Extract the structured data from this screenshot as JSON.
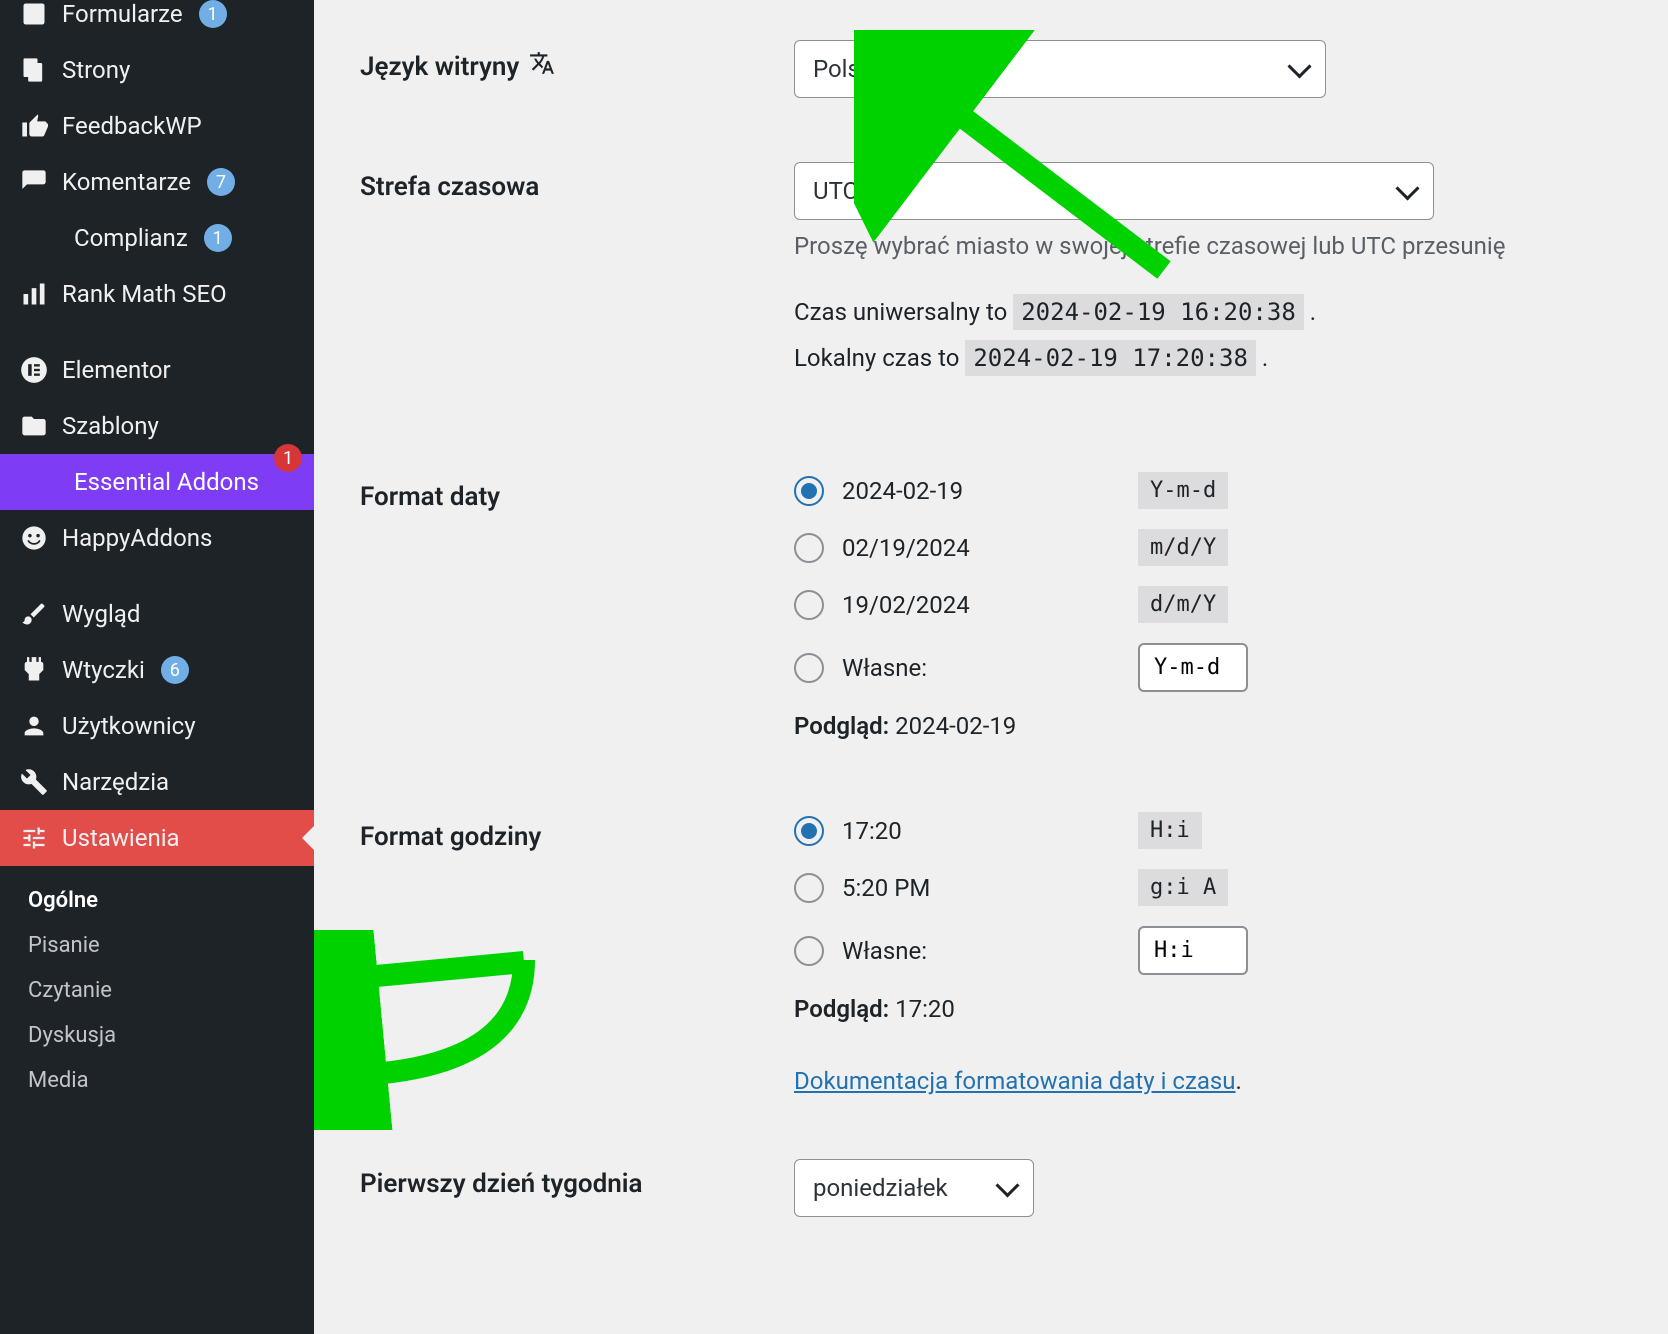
{
  "sidebar": {
    "items": {
      "formularze": {
        "label": "Formularze",
        "badge": "1"
      },
      "strony": {
        "label": "Strony"
      },
      "feedbackwp": {
        "label": "FeedbackWP"
      },
      "komentarze": {
        "label": "Komentarze",
        "badge": "7"
      },
      "complianz": {
        "label": "Complianz",
        "badge": "1"
      },
      "rankmath": {
        "label": "Rank Math SEO"
      },
      "elementor": {
        "label": "Elementor"
      },
      "szablony": {
        "label": "Szablony"
      },
      "essential": {
        "label": "Essential Addons",
        "badge": "1"
      },
      "happy": {
        "label": "HappyAddons"
      },
      "wyglad": {
        "label": "Wygląd"
      },
      "wtyczki": {
        "label": "Wtyczki",
        "badge": "6"
      },
      "uzytkownicy": {
        "label": "Użytkownicy"
      },
      "narzedzia": {
        "label": "Narzędzia"
      },
      "ustawienia": {
        "label": "Ustawienia"
      }
    },
    "submenu": {
      "ogolne": "Ogólne",
      "pisanie": "Pisanie",
      "czytanie": "Czytanie",
      "dyskusja": "Dyskusja",
      "media": "Media"
    }
  },
  "settings": {
    "language": {
      "label": "Język witryny",
      "value": "Polski"
    },
    "timezone": {
      "label": "Strefa czasowa",
      "value": "UTC+1",
      "help": "Proszę wybrać miasto w swojej strefie czasowej lub UTC przesunię",
      "utc_prefix": "Czas uniwersalny to ",
      "utc_value": "2024-02-19 16:20:38",
      "local_prefix": "Lokalny czas to ",
      "local_value": "2024-02-19 17:20:38"
    },
    "date_format": {
      "label": "Format daty",
      "options": [
        {
          "display": "2024-02-19",
          "format": "Y-m-d",
          "checked": true
        },
        {
          "display": "02/19/2024",
          "format": "m/d/Y",
          "checked": false
        },
        {
          "display": "19/02/2024",
          "format": "d/m/Y",
          "checked": false
        }
      ],
      "custom_label": "Własne:",
      "custom_value": "Y-m-d",
      "preview_label": "Podgląd:",
      "preview_value": "2024-02-19"
    },
    "time_format": {
      "label": "Format godziny",
      "options": [
        {
          "display": "17:20",
          "format": "H:i",
          "checked": true
        },
        {
          "display": "5:20 PM",
          "format": "g:i A",
          "checked": false
        }
      ],
      "custom_label": "Własne:",
      "custom_value": "H:i",
      "preview_label": "Podgląd:",
      "preview_value": "17:20",
      "doc_link": "Dokumentacja formatowania daty i czasu"
    },
    "first_day": {
      "label": "Pierwszy dzień tygodnia",
      "value": "poniedziałek"
    }
  }
}
